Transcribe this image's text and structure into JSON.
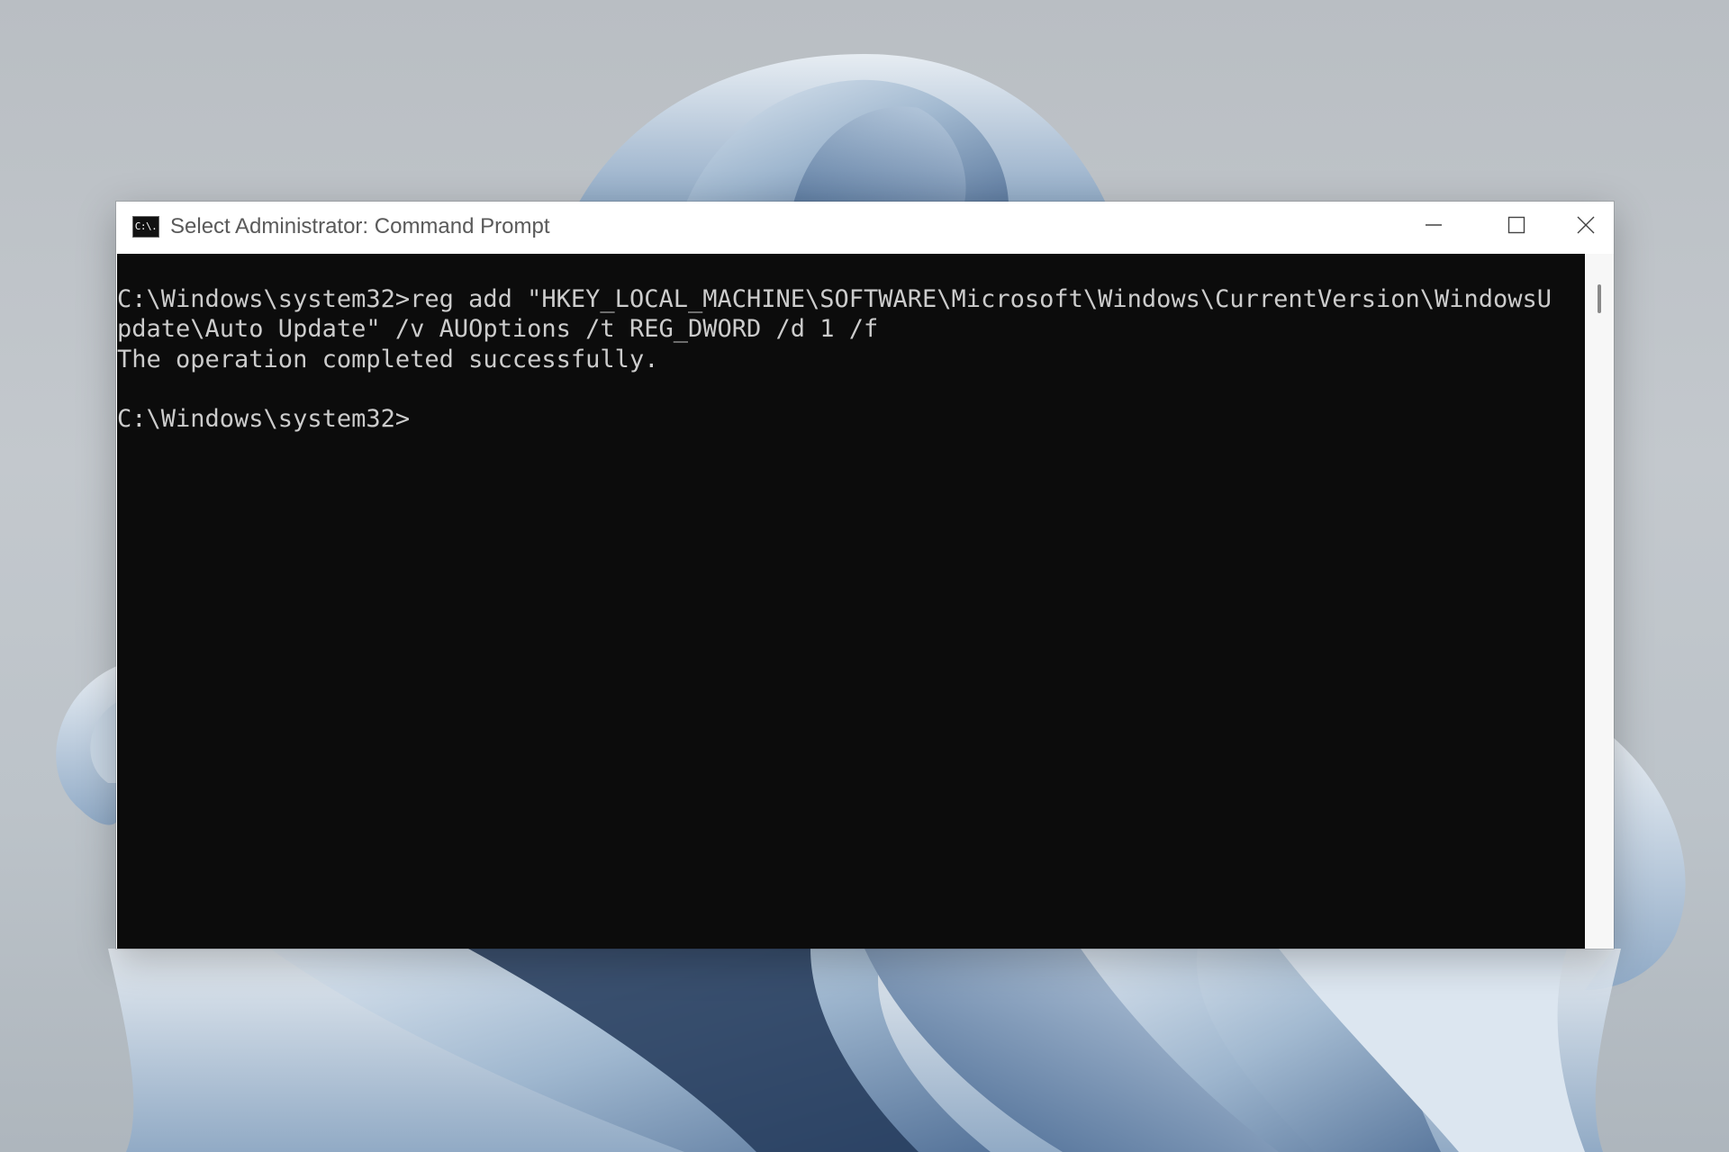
{
  "window": {
    "title": "Select Administrator: Command Prompt",
    "icon_label": "C:\\.",
    "controls": [
      "minimize-icon",
      "maximize-icon",
      "close-icon"
    ]
  },
  "terminal": {
    "lines": [
      "C:\\Windows\\system32>reg add \"HKEY_LOCAL_MACHINE\\SOFTWARE\\Microsoft\\Windows\\CurrentVersion\\WindowsU",
      "pdate\\Auto Update\" /v AUOptions /t REG_DWORD /d 1 /f",
      "The operation completed successfully.",
      "",
      "C:\\Windows\\system32>"
    ],
    "background_color": "#0c0c0c",
    "text_color": "#cccccc"
  },
  "colors": {
    "titlebar": "#ffffff",
    "title_text": "#5a5a5a"
  }
}
